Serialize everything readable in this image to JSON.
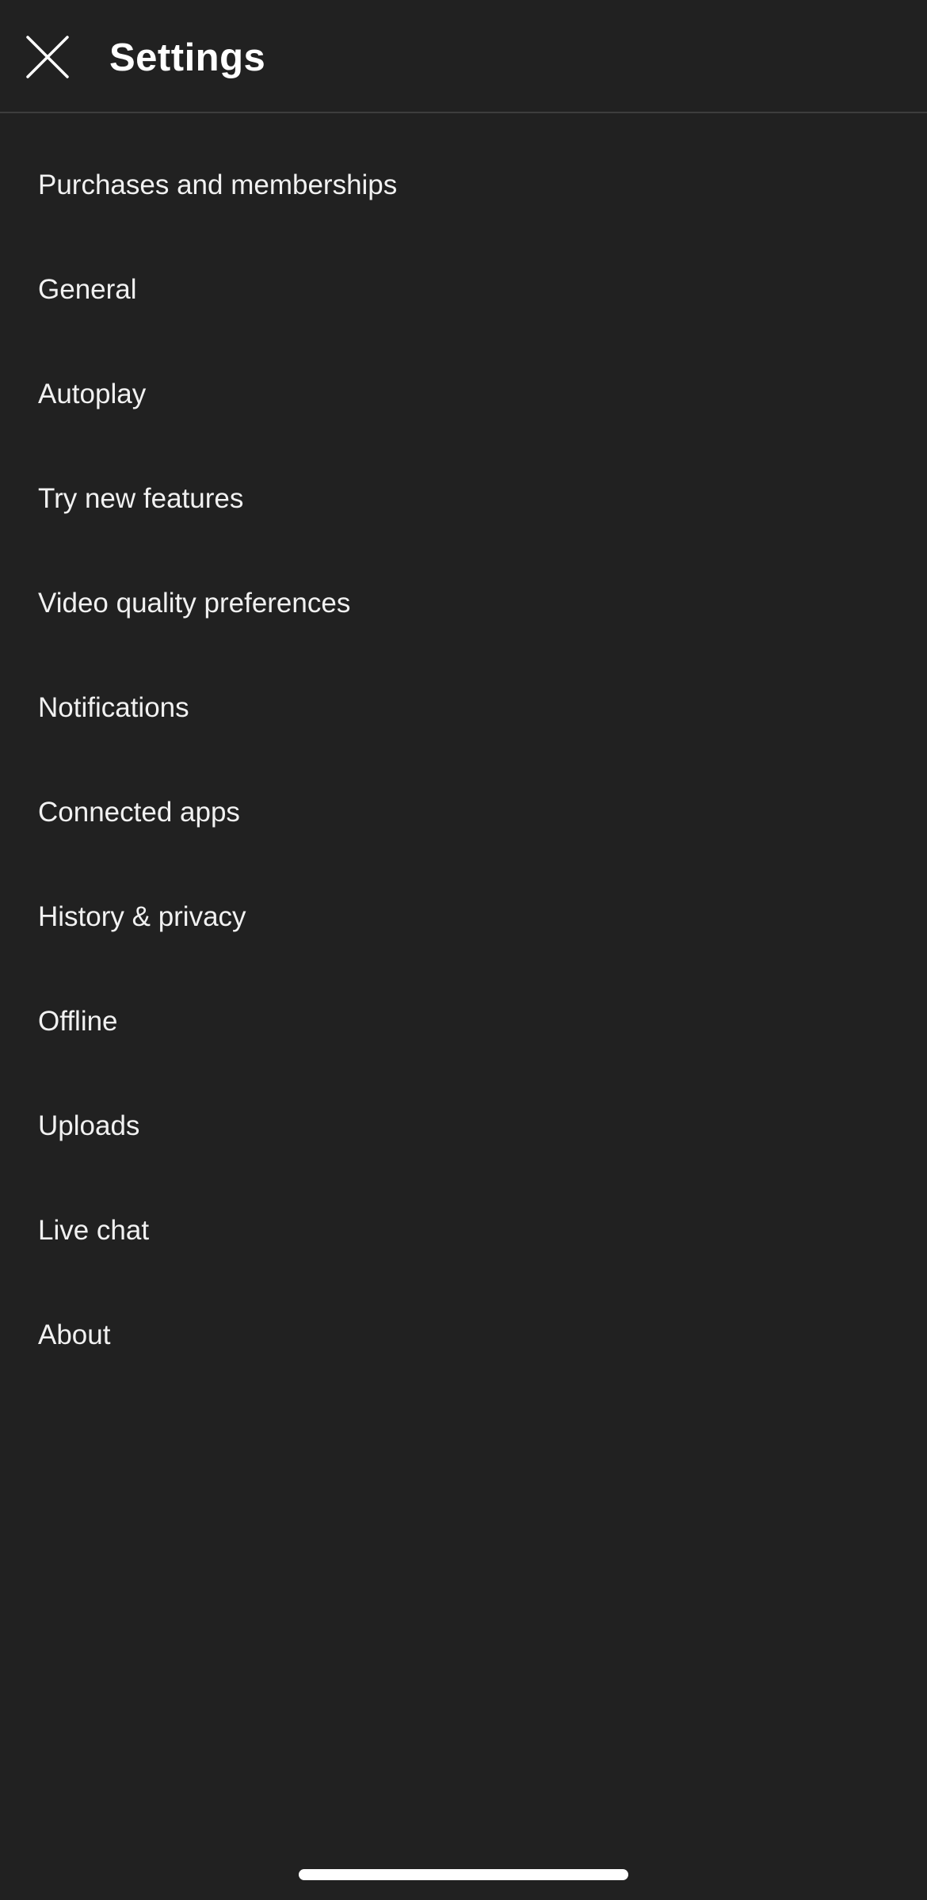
{
  "header": {
    "title": "Settings",
    "close_icon": "close-icon"
  },
  "settings": {
    "items": [
      {
        "label": "Purchases and memberships"
      },
      {
        "label": "General"
      },
      {
        "label": "Autoplay"
      },
      {
        "label": "Try new features"
      },
      {
        "label": "Video quality preferences"
      },
      {
        "label": "Notifications"
      },
      {
        "label": "Connected apps"
      },
      {
        "label": "History & privacy"
      },
      {
        "label": "Offline"
      },
      {
        "label": "Uploads"
      },
      {
        "label": "Live chat"
      },
      {
        "label": "About"
      }
    ]
  },
  "colors": {
    "background": "#212121",
    "text": "#ffffff",
    "divider": "#3d3d3d"
  }
}
